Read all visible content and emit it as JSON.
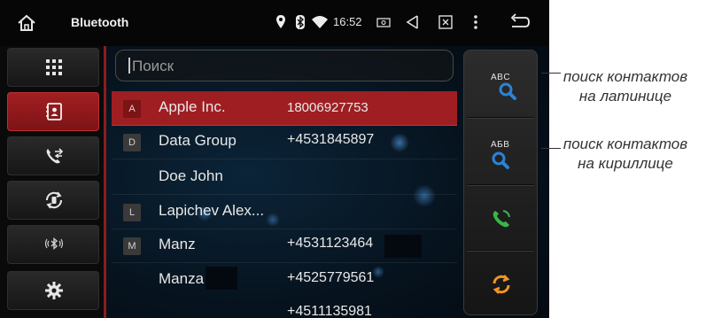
{
  "status_bar": {
    "title": "Bluetooth",
    "time": "16:52",
    "icons": [
      "home-icon",
      "location-pin-icon",
      "bluetooth-icon",
      "wifi-icon",
      "screenshot-icon",
      "volume-icon",
      "close-box-icon",
      "more-vert-icon",
      "back-icon"
    ]
  },
  "sidebar": {
    "items": [
      {
        "icon": "dialpad-icon",
        "active": false
      },
      {
        "icon": "contacts-book-icon",
        "active": true
      },
      {
        "icon": "call-log-icon",
        "active": false
      },
      {
        "icon": "phone-sync-icon",
        "active": false
      },
      {
        "icon": "bluetooth-music-icon",
        "active": false
      },
      {
        "icon": "settings-gear-icon",
        "active": false
      }
    ]
  },
  "search": {
    "placeholder": "Поиск",
    "value": ""
  },
  "contacts": [
    {
      "letter": "A",
      "name": "Apple Inc.",
      "phone": "18006927753",
      "selected": true
    },
    {
      "letter": "D",
      "name": "Data Group",
      "phone": "+4531845897",
      "selected": false
    },
    {
      "letter": "",
      "name": "Doe John",
      "phone": "",
      "selected": false
    },
    {
      "letter": "L",
      "name": "Lapichev Alex...",
      "phone": "",
      "selected": false
    },
    {
      "letter": "M",
      "name": "Manz",
      "phone": "+4531123464",
      "selected": false
    },
    {
      "letter": "",
      "name": "Manza",
      "phone": "+4525779561",
      "selected": false
    },
    {
      "letter": "",
      "name": "",
      "phone": "+4511135981",
      "selected": false
    }
  ],
  "actions": {
    "latin_search": {
      "label": "ABC",
      "icon": "search-latin-icon"
    },
    "cyrillic_search": {
      "label": "АБВ",
      "icon": "search-cyrillic-icon"
    },
    "call": {
      "icon": "phone-call-icon"
    },
    "sync": {
      "icon": "sync-icon"
    }
  },
  "annotations": {
    "latin": {
      "line1": "поиск контактов",
      "line2": "на латинице"
    },
    "cyrillic": {
      "line1": "поиск контактов",
      "line2": "на кириллице"
    }
  },
  "colors": {
    "accent_red": "#9f1e22",
    "search_blue": "#2c83d6",
    "call_green": "#39b54a",
    "sync_orange": "#f0961e"
  }
}
